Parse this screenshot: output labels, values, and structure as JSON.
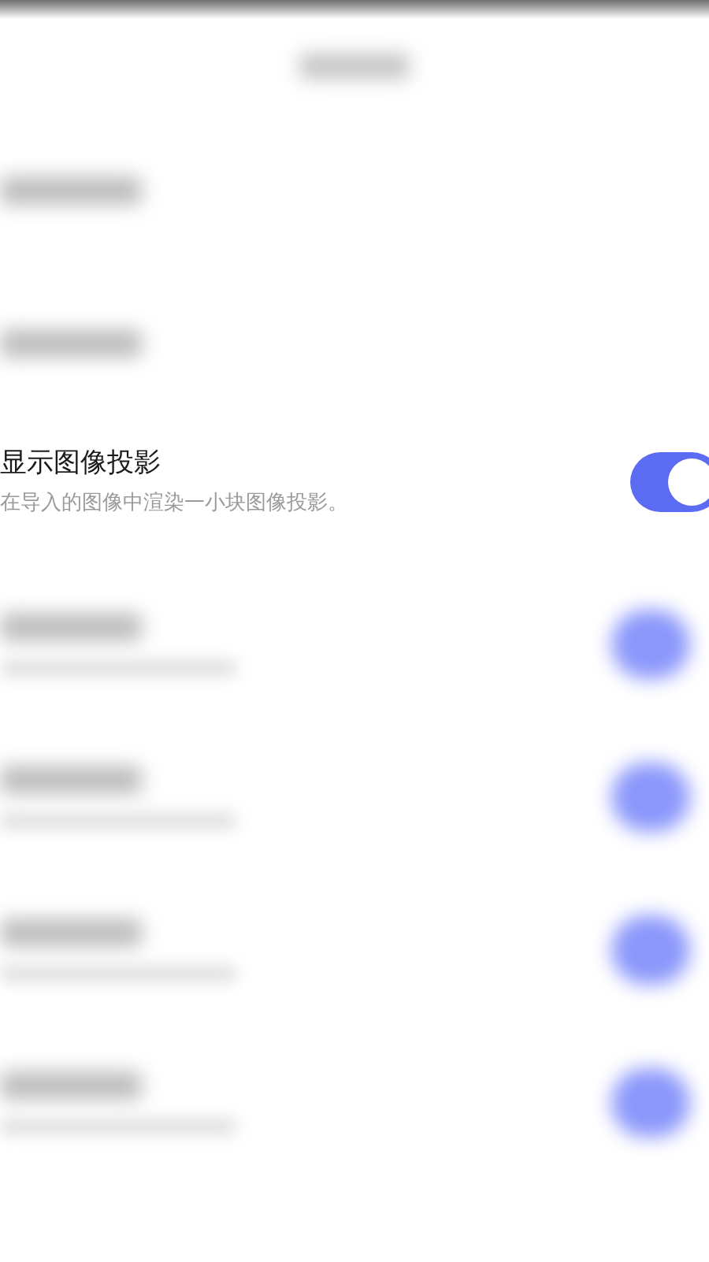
{
  "rows_above": [
    {
      "kind": "plain"
    },
    {
      "kind": "plain"
    }
  ],
  "setting": {
    "title": "显示图像投影",
    "description": "在导入的图像中渲染一小块图像投影。",
    "on": true
  },
  "rows_below": [
    {
      "kind": "toggle",
      "on": true
    },
    {
      "kind": "toggle",
      "on": true
    },
    {
      "kind": "toggle",
      "on": true
    },
    {
      "kind": "toggle",
      "on": true
    }
  ]
}
